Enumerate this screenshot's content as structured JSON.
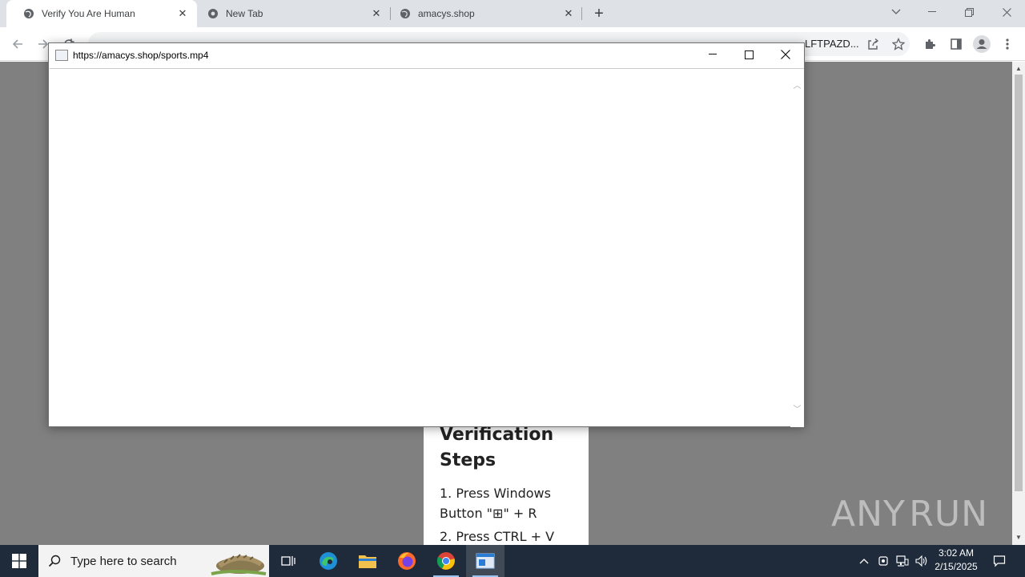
{
  "browser": {
    "tabs": [
      {
        "title": "Verify You Are Human",
        "active": true
      },
      {
        "title": "New Tab",
        "active": false
      },
      {
        "title": "amacys.shop",
        "active": false
      }
    ],
    "url_tail": "LFTPAZD..."
  },
  "page": {
    "card": {
      "heading": "Verification Steps",
      "step1": "1. Press Windows Button \"⊞\" + R",
      "step2": "2. Press CTRL + V"
    },
    "watermark": {
      "left": "ANY",
      "right": "RUN"
    }
  },
  "popup": {
    "title": "https://amacys.shop/sports.mp4"
  },
  "taskbar": {
    "search_placeholder": "Type here to search",
    "time": "3:02 AM",
    "date": "2/15/2025"
  },
  "colors": {
    "tabstrip": "#dee1e6",
    "page_bg": "#808080",
    "taskbar": "#1f2b3a"
  }
}
